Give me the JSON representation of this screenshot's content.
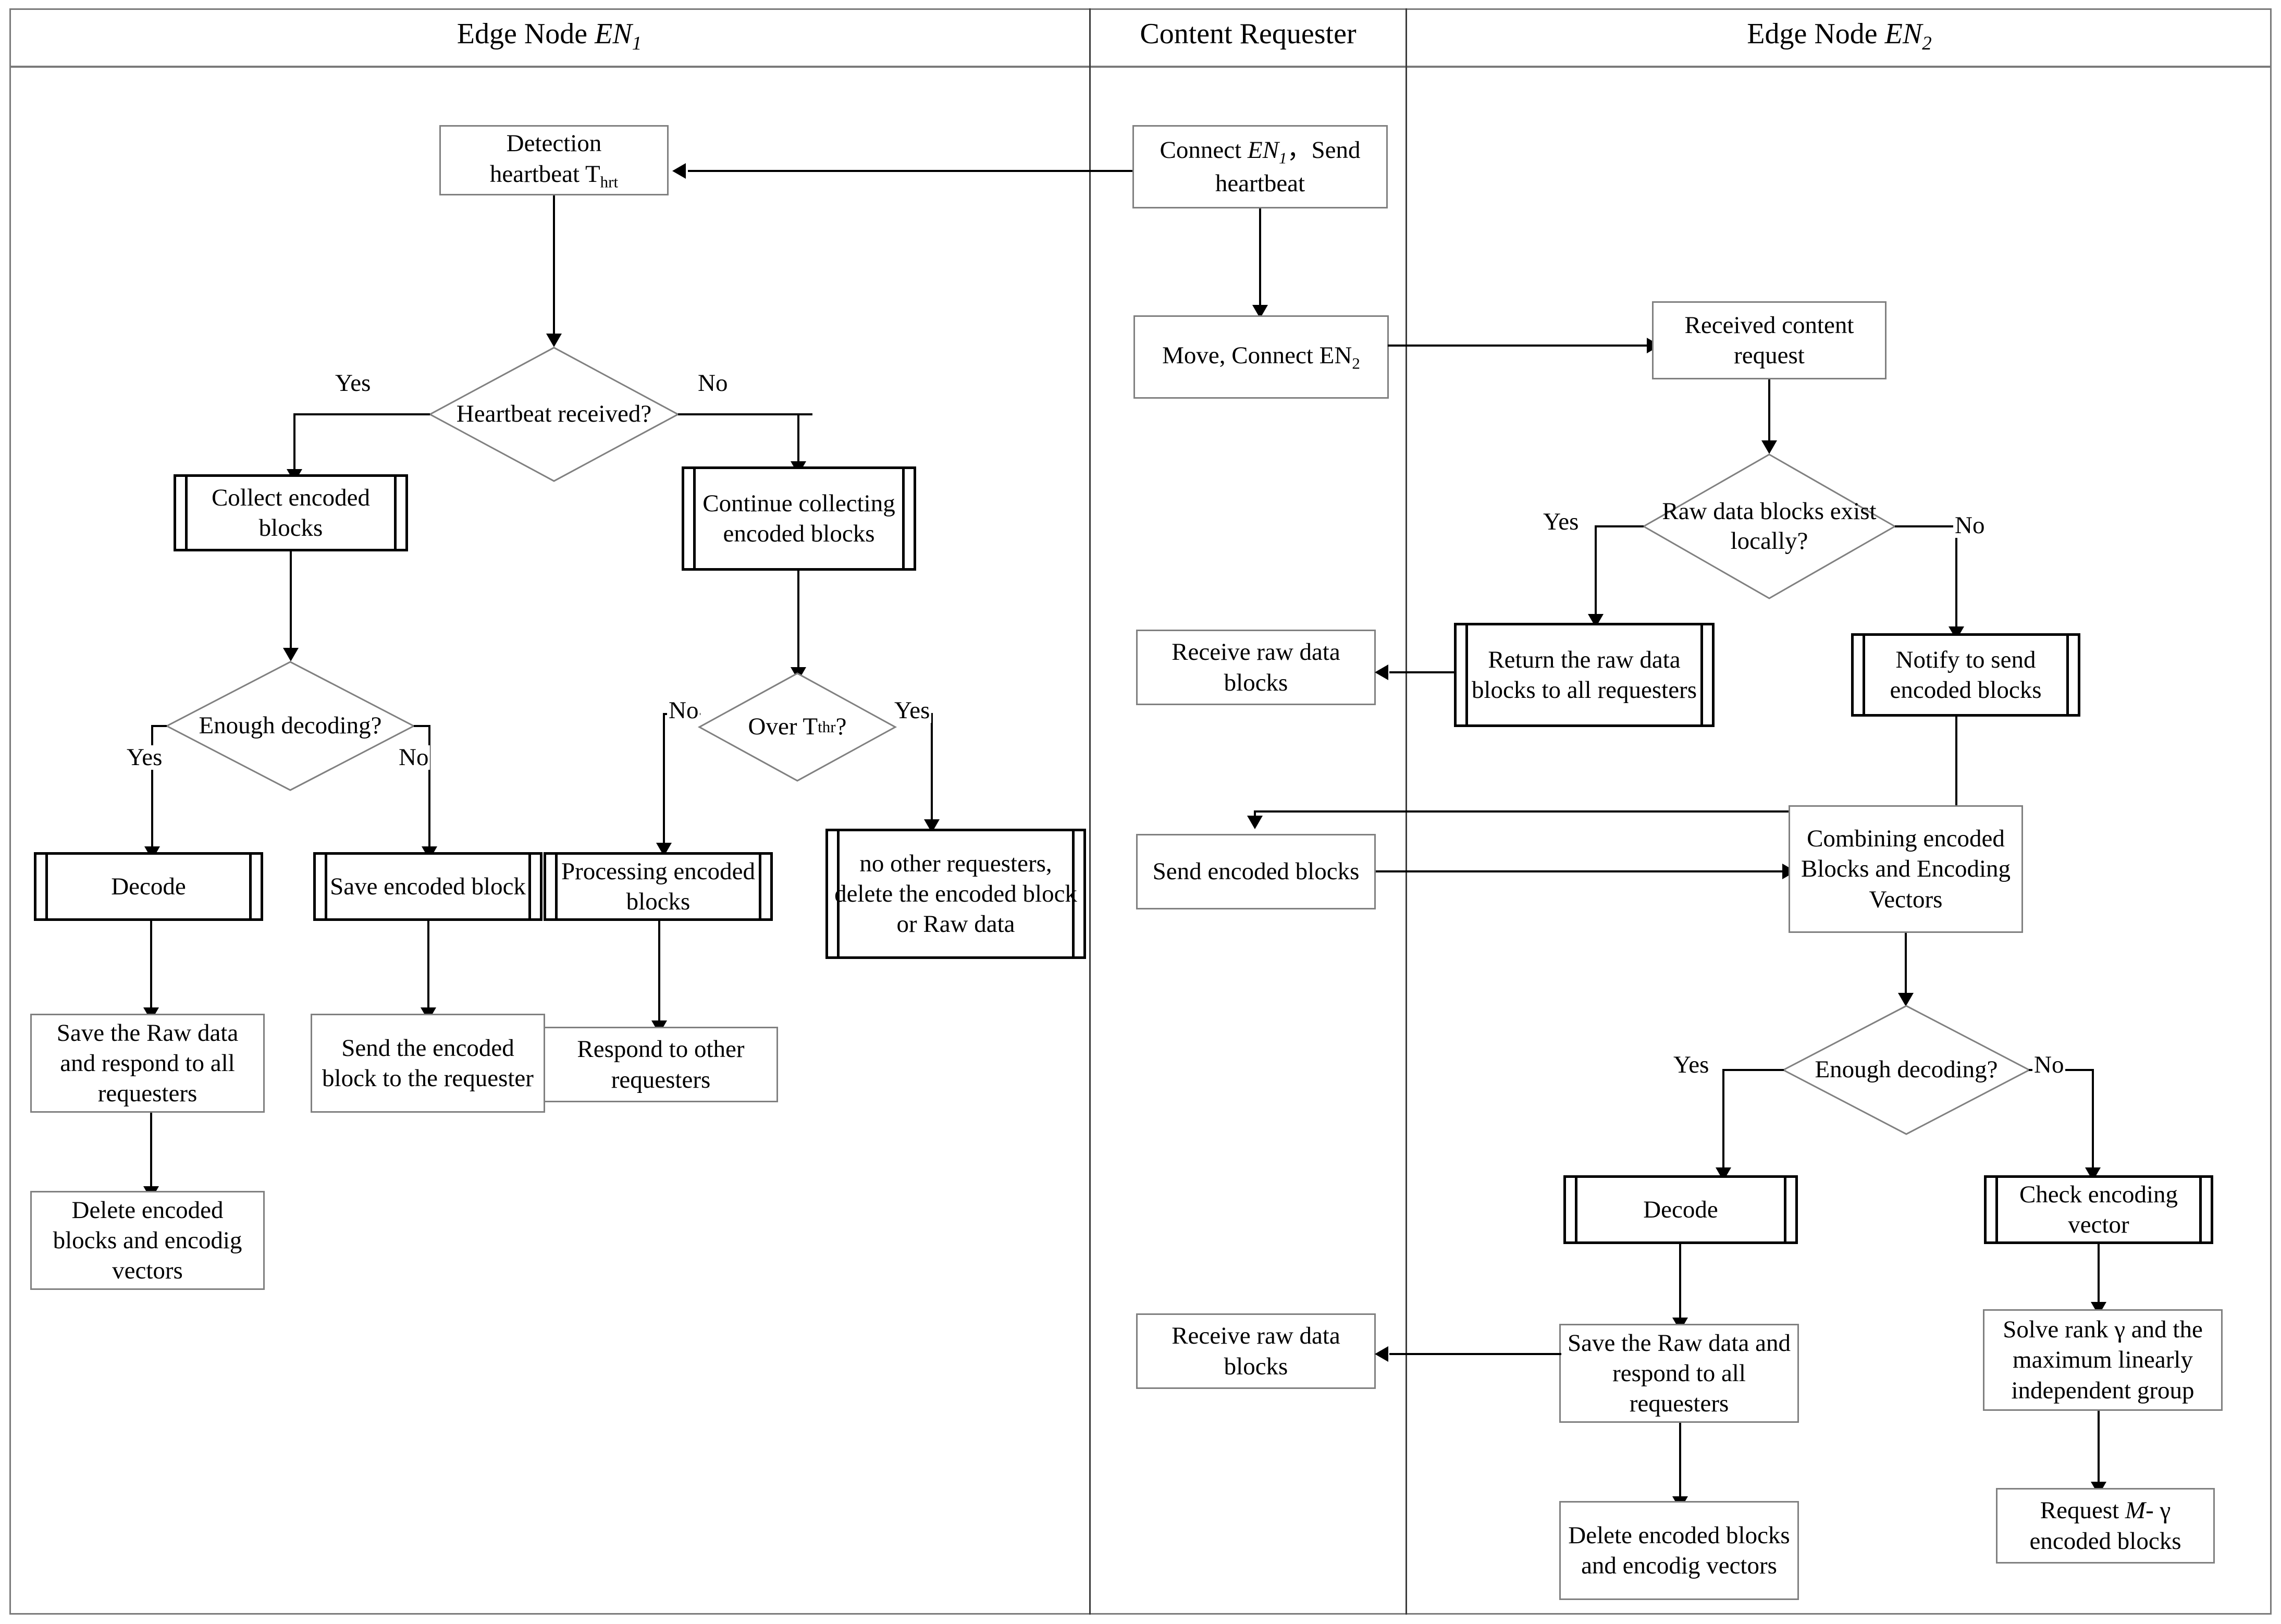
{
  "lanes": [
    {
      "id": "en1",
      "title_pre": "Edge Node ",
      "title_em": "EN",
      "title_sub": "1"
    },
    {
      "id": "requester",
      "title_pre": "Content Requester",
      "title_em": "",
      "title_sub": ""
    },
    {
      "id": "en2",
      "title_pre": "Edge Node ",
      "title_em": "EN",
      "title_sub": "2"
    }
  ],
  "lane_titles": {
    "en1": "Edge Node EN1",
    "requester": "Content Requester",
    "en2": "Edge Node EN2"
  },
  "nodes": {
    "detection_heartbeat": "Detection heartbeat T",
    "detection_heartbeat_sub": "hrt",
    "heartbeat_received": "Heartbeat received?",
    "collect_encoded_blocks": "Collect encoded blocks",
    "continue_collecting": "Continue collecting encoded blocks",
    "enough_decoding_left": "Enough decoding?",
    "over_tthr": "Over T",
    "over_tthr_sub": "thr",
    "over_tthr_tail": "?",
    "decode_left": "Decode",
    "save_encoded_block": "Save encoded block",
    "processing_encoded_blocks": "Processing encoded blocks",
    "no_other_requesters": "no other requesters, delete the encoded block or Raw data",
    "save_raw_respond_left": "Save the Raw data and respond to all requesters",
    "send_encoded_block_to_requester": "Send the encoded block to the requester",
    "respond_to_other_requesters": "Respond to other requesters",
    "delete_encoded_left": "Delete encoded blocks and encodig vectors",
    "connect_en1_send_heartbeat_pre": "Connect ",
    "connect_en1_send_heartbeat_em": "EN",
    "connect_en1_send_heartbeat_sub": "1",
    "connect_en1_send_heartbeat_post": ", Send heartbeat",
    "move_connect_en2": "Move, Connect EN",
    "move_connect_en2_sub": "2",
    "receive_raw_data_blocks_1": "Receive raw data blocks",
    "send_encoded_blocks": "Send encoded blocks",
    "receive_raw_data_blocks_2": "Receive raw data blocks",
    "received_content_request": "Received content request",
    "raw_data_blocks_exist": "Raw data blocks exist locally?",
    "return_raw_to_all": "Return the raw data blocks to all requesters",
    "notify_to_send_encoded": "Notify to send encoded blocks",
    "combining_blocks_vectors": "Combining encoded Blocks and Encoding Vectors",
    "enough_decoding_right": "Enough decoding?",
    "decode_right": "Decode",
    "check_encoding_vector": "Check encoding vector",
    "save_raw_respond_right": "Save the Raw data and respond to all requesters",
    "delete_encoded_right": "Delete encoded blocks and encodig vectors",
    "solve_rank": "Solve rank γ and the maximum linearly independent group",
    "request_m_gamma_pre": "Request ",
    "request_m_gamma_em": "M",
    "request_m_gamma_post": "- γ encoded blocks"
  },
  "edge_labels": {
    "hb_yes": "Yes",
    "hb_no": "No",
    "dec_left_yes": "Yes",
    "dec_left_no": "No",
    "tthr_no": "No",
    "tthr_yes": "Yes",
    "raw_yes": "Yes",
    "raw_no": "No",
    "dec_right_yes": "Yes",
    "dec_right_no": "No"
  },
  "colors": {
    "shape_border": "#808080",
    "process_border": "#000000",
    "connector": "#000000",
    "lane_divider": "#3a3a3a",
    "background": "#ffffff"
  }
}
